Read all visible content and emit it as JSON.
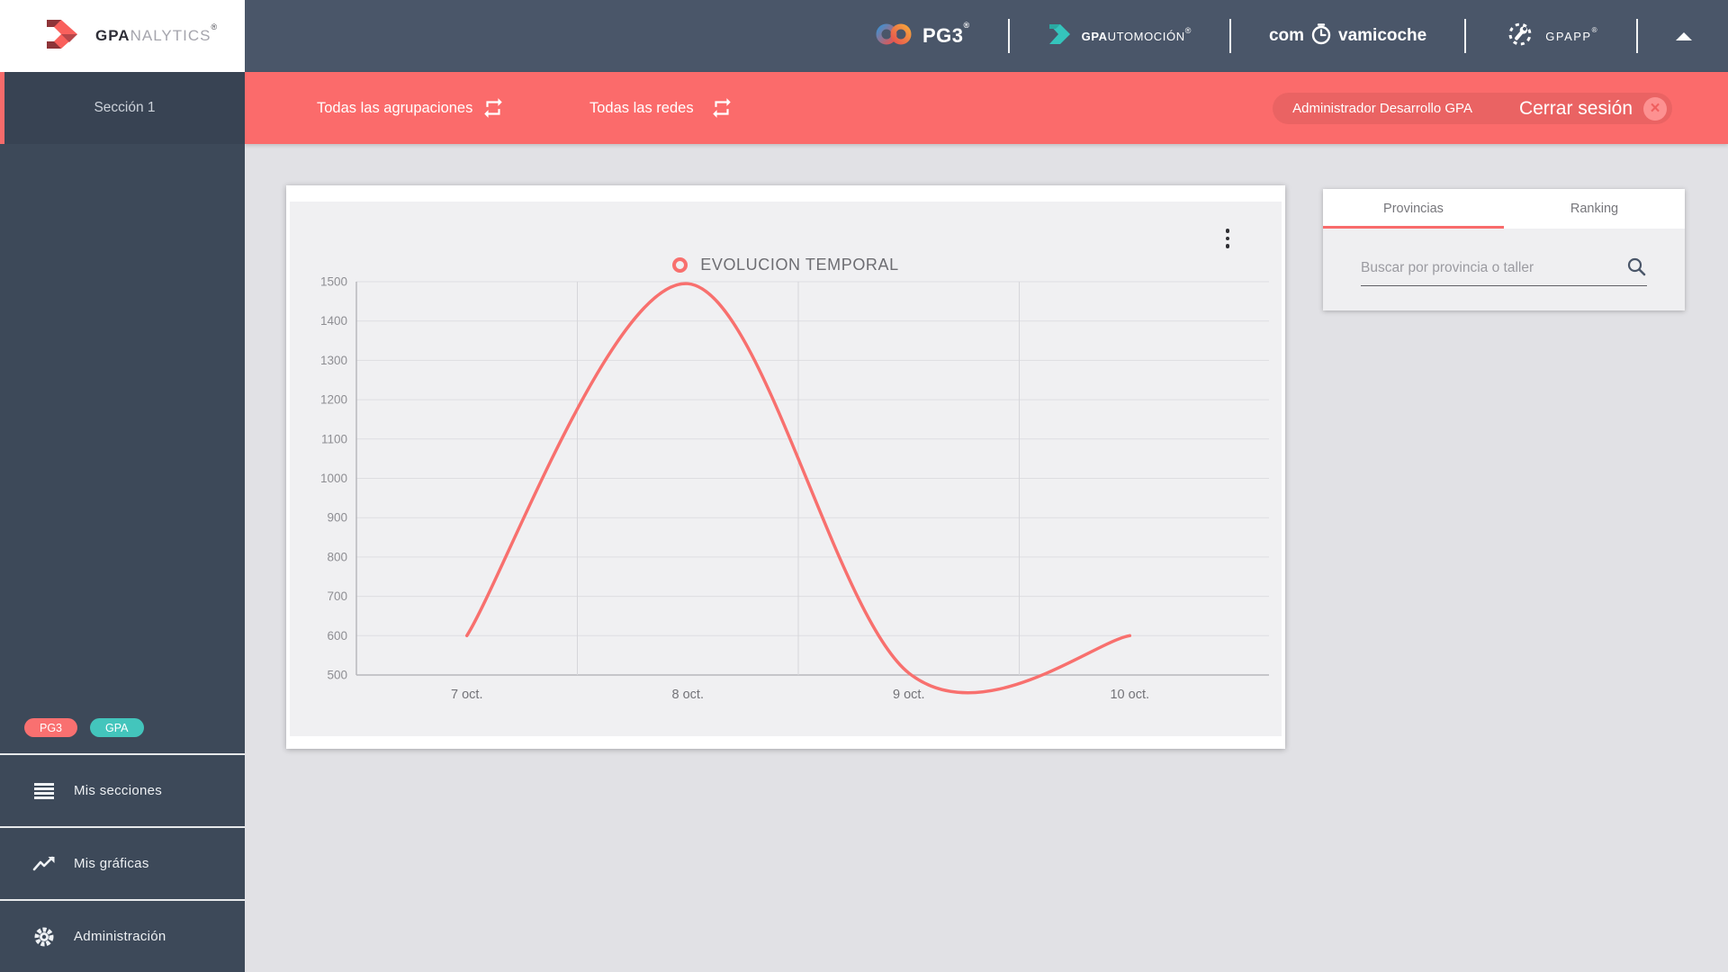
{
  "header": {
    "brand": {
      "bold": "GPA",
      "rest": "NALYTICS",
      "reg": "®"
    },
    "partners": {
      "pg3": {
        "label": "PG3",
        "reg": "®"
      },
      "gpautomocion": {
        "bold": "GPA",
        "rest": "UTOMOCIÓN",
        "reg": "®"
      },
      "comprovamicoche": {
        "pre": "com",
        "post": "vamicoche"
      },
      "gpapp": {
        "label": "GPAPP",
        "reg": "®"
      }
    }
  },
  "toolbar": {
    "filters": [
      {
        "label": "Todas las agrupaciones"
      },
      {
        "label": "Todas las redes"
      }
    ],
    "user": "Administrador Desarrollo GPA",
    "logout_label": "Cerrar sesión",
    "logout_x": "×",
    "accent_color": "#fb6b6b"
  },
  "sidebar": {
    "section": "Sección 1",
    "badges": [
      {
        "label": "PG3",
        "color": "#f97070"
      },
      {
        "label": "GPA",
        "color": "#43c5bc"
      }
    ],
    "menu": [
      {
        "label": "Mis secciones",
        "icon": "menu-icon"
      },
      {
        "label": "Mis gráficas",
        "icon": "trend-icon"
      },
      {
        "label": "Administración",
        "icon": "gear-icon"
      }
    ]
  },
  "chart_data": {
    "type": "line",
    "title": "EVOLUCION TEMPORAL",
    "series_name": "EVOLUCION TEMPORAL",
    "x": [
      "7 oct.",
      "8 oct.",
      "9 oct.",
      "10 oct."
    ],
    "values": [
      600,
      1495,
      505,
      600
    ],
    "ylim": [
      500,
      1500
    ],
    "ytick_step": 100,
    "line_color": "#f8706e",
    "grid": true,
    "legend_position": "top-center"
  },
  "panel": {
    "tabs": [
      {
        "label": "Provincias",
        "active": true
      },
      {
        "label": "Ranking",
        "active": false
      }
    ],
    "search_placeholder": "Buscar por provincia o taller"
  }
}
